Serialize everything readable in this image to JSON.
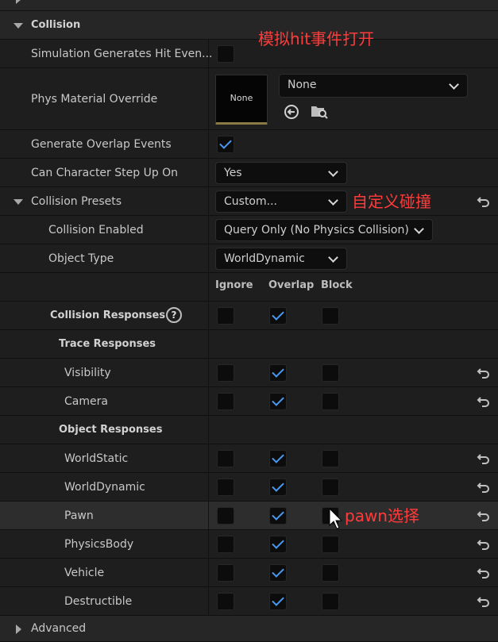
{
  "annotations": {
    "hit_note": "模拟hit事件打开",
    "custom_note": "自定义碰撞",
    "pawn_note": "pawn选择"
  },
  "sections": {
    "collision": "Collision",
    "advanced": "Advanced"
  },
  "properties": {
    "sim_hit": {
      "label": "Simulation Generates Hit Even...",
      "checked": false
    },
    "phys_material": {
      "label": "Phys Material Override",
      "thumb_text": "None",
      "value": "None"
    },
    "overlap_events": {
      "label": "Generate Overlap Events",
      "checked": true
    },
    "step_up": {
      "label": "Can Character Step Up On",
      "value": "Yes"
    },
    "presets": {
      "label": "Collision Presets",
      "value": "Custom..."
    },
    "enabled": {
      "label": "Collision Enabled",
      "value": "Query Only (No Physics Collision)"
    },
    "object_type": {
      "label": "Object Type",
      "value": "WorldDynamic"
    }
  },
  "columns": {
    "ignore": "Ignore",
    "overlap": "Overlap",
    "block": "Block"
  },
  "responses": {
    "title": "Collision Responses",
    "help": "?",
    "trace_header": "Trace Responses",
    "object_header": "Object Responses",
    "rows": [
      {
        "label": "Visibility",
        "ignore": false,
        "overlap": true,
        "block": false
      },
      {
        "label": "Camera",
        "ignore": false,
        "overlap": true,
        "block": false
      },
      {
        "label": "WorldStatic",
        "ignore": false,
        "overlap": true,
        "block": false
      },
      {
        "label": "WorldDynamic",
        "ignore": false,
        "overlap": true,
        "block": false
      },
      {
        "label": "Pawn",
        "ignore": false,
        "overlap": true,
        "block": false
      },
      {
        "label": "PhysicsBody",
        "ignore": false,
        "overlap": true,
        "block": false
      },
      {
        "label": "Vehicle",
        "ignore": false,
        "overlap": true,
        "block": false
      },
      {
        "label": "Destructible",
        "ignore": false,
        "overlap": true,
        "block": false
      }
    ]
  },
  "colors": {
    "accent": "#4b98f0",
    "annotation": "#ff3b3b"
  },
  "icons": [
    "reset-icon",
    "use-selected-icon",
    "browse-icon",
    "help-icon",
    "checkmark-icon",
    "chevron-down-icon",
    "mouse-cursor-icon"
  ]
}
